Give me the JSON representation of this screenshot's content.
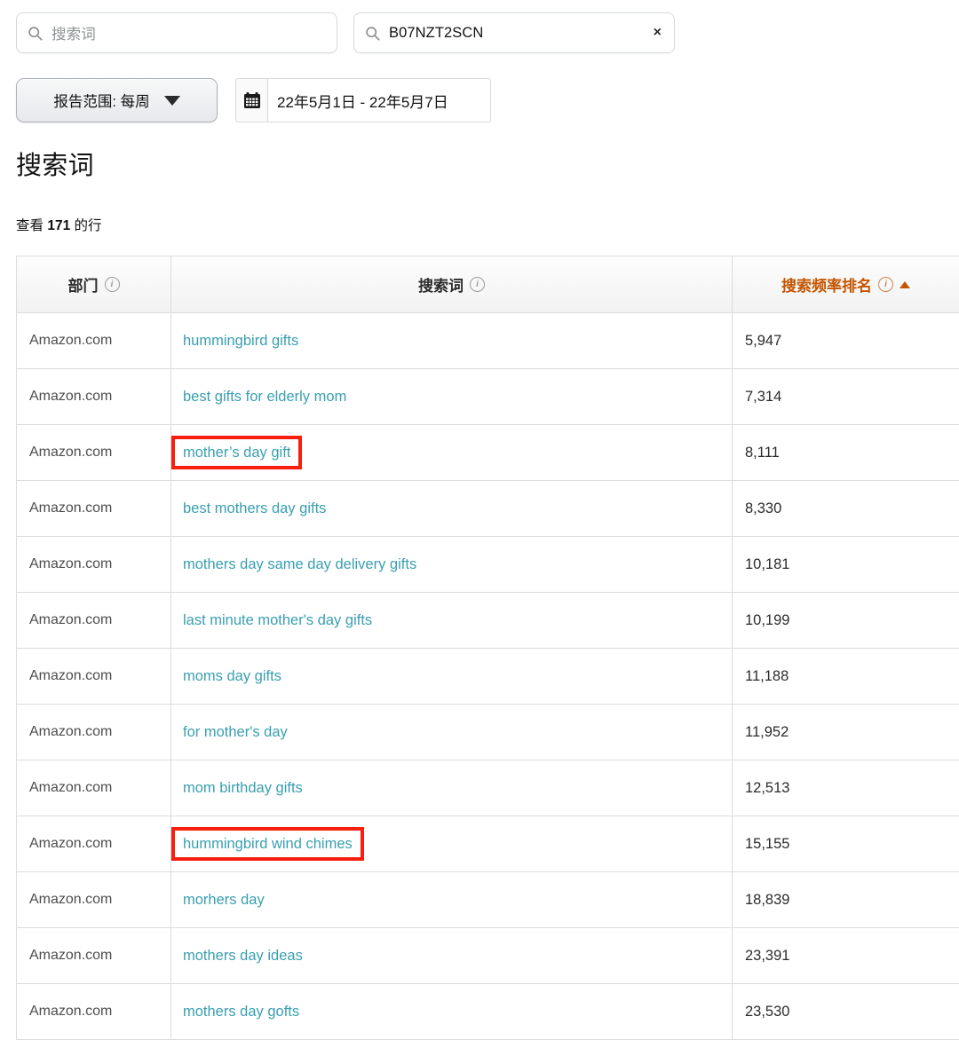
{
  "filters": {
    "search_term": {
      "icon": "search-icon",
      "placeholder": "搜索词",
      "value": ""
    },
    "asin_search": {
      "icon": "search-icon",
      "value": "B07NZT2SCN",
      "clear_label": "×"
    },
    "report_range": {
      "label": "报告范围: 每周",
      "caret": "chevron-down-icon"
    },
    "date_range": {
      "icon": "calendar-icon",
      "value": "22年5月1日 - 22年5月7日"
    }
  },
  "page": {
    "title": "搜索词",
    "row_count_prefix": "查看",
    "row_count": "171",
    "row_count_suffix": "的行"
  },
  "table": {
    "columns": [
      {
        "label": "部门",
        "info": "info-icon",
        "sorted": false
      },
      {
        "label": "搜索词",
        "info": "info-icon",
        "sorted": false
      },
      {
        "label": "搜索频率排名",
        "info": "info-icon",
        "sorted": true,
        "sort_dir": "asc"
      }
    ],
    "rows": [
      {
        "department": "Amazon.com",
        "term": "hummingbird gifts",
        "rank": "5,947",
        "highlight": false
      },
      {
        "department": "Amazon.com",
        "term": "best gifts for elderly mom",
        "rank": "7,314",
        "highlight": false
      },
      {
        "department": "Amazon.com",
        "term": "mother’s day gift",
        "rank": "8,111",
        "highlight": true
      },
      {
        "department": "Amazon.com",
        "term": "best mothers day gifts",
        "rank": "8,330",
        "highlight": false
      },
      {
        "department": "Amazon.com",
        "term": "mothers day same day delivery gifts",
        "rank": "10,181",
        "highlight": false
      },
      {
        "department": "Amazon.com",
        "term": "last minute mother's day gifts",
        "rank": "10,199",
        "highlight": false
      },
      {
        "department": "Amazon.com",
        "term": "moms day gifts",
        "rank": "11,188",
        "highlight": false
      },
      {
        "department": "Amazon.com",
        "term": "for mother's day",
        "rank": "11,952",
        "highlight": false
      },
      {
        "department": "Amazon.com",
        "term": "mom birthday gifts",
        "rank": "12,513",
        "highlight": false
      },
      {
        "department": "Amazon.com",
        "term": "hummingbird wind chimes",
        "rank": "15,155",
        "highlight": true
      },
      {
        "department": "Amazon.com",
        "term": "morhers day",
        "rank": "18,839",
        "highlight": false
      },
      {
        "department": "Amazon.com",
        "term": "mothers day ideas",
        "rank": "23,391",
        "highlight": false
      },
      {
        "department": "Amazon.com",
        "term": "mothers day gofts",
        "rank": "23,530",
        "highlight": false
      }
    ]
  },
  "colors": {
    "link": "#3a9fb0",
    "sorted_header": "#c45500",
    "highlight_box": "#f81f0f",
    "border": "#dcdcdc"
  }
}
